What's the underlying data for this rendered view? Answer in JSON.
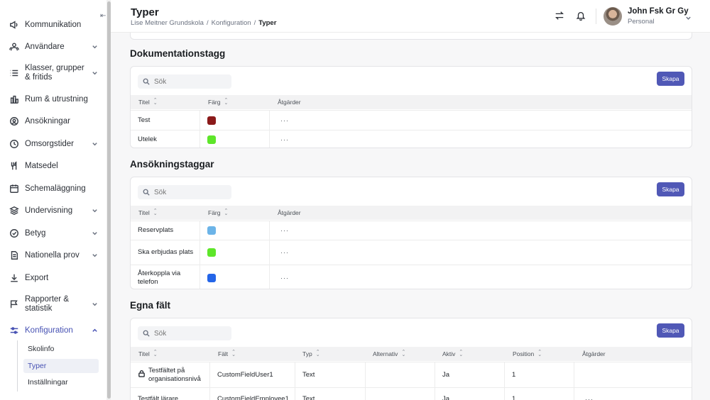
{
  "header": {
    "title": "Typer",
    "breadcrumb": [
      "Lise Meitner Grundskola",
      "Konfiguration",
      "Typer"
    ],
    "user_name": "John Fsk Gr Gy",
    "user_role": "Personal"
  },
  "sidebar": {
    "items": [
      {
        "label": "Kommunikation",
        "icon": "megaphone-icon"
      },
      {
        "label": "Användare",
        "icon": "users-icon"
      },
      {
        "label": "Klasser, grupper & fritids",
        "icon": "list-icon"
      },
      {
        "label": "Rum & utrustning",
        "icon": "building-icon"
      },
      {
        "label": "Ansökningar",
        "icon": "user-circle-icon"
      },
      {
        "label": "Omsorgstider",
        "icon": "clock-icon"
      },
      {
        "label": "Matsedel",
        "icon": "fork-knife-icon"
      },
      {
        "label": "Schemaläggning",
        "icon": "calendar-icon"
      },
      {
        "label": "Undervisning",
        "icon": "layers-icon"
      },
      {
        "label": "Betyg",
        "icon": "check-circle-icon"
      },
      {
        "label": "Nationella prov",
        "icon": "document-icon"
      },
      {
        "label": "Export",
        "icon": "download-icon"
      },
      {
        "label": "Rapporter & statistik",
        "icon": "flag-icon"
      },
      {
        "label": "Konfiguration",
        "icon": "sliders-icon"
      }
    ],
    "sub_items": [
      "Skolinfo",
      "Typer",
      "Inställningar"
    ]
  },
  "sections": {
    "doc_tags": {
      "title": "Dokumentationstagg",
      "search_placeholder": "Sök",
      "create_label": "Skapa",
      "columns": [
        "Titel",
        "Färg",
        "Åtgärder"
      ],
      "rows": [
        {
          "title": "Test",
          "color": "#8b1a1a",
          "actions": "···"
        },
        {
          "title": "Utelek",
          "color": "#5ee62a",
          "actions": "···"
        }
      ]
    },
    "app_tags": {
      "title": "Ansökningstaggar",
      "search_placeholder": "Sök",
      "create_label": "Skapa",
      "columns": [
        "Titel",
        "Färg",
        "Åtgärder"
      ],
      "rows": [
        {
          "title": "Reservplats",
          "color": "#6cb4e8",
          "actions": "···"
        },
        {
          "title": "Ska erbjudas plats",
          "color": "#5ee62a",
          "actions": "···"
        },
        {
          "title": "Återkoppla via telefon",
          "color": "#2465e8",
          "actions": "···"
        }
      ]
    },
    "custom_fields": {
      "title": "Egna fält",
      "search_placeholder": "Sök",
      "create_label": "Skapa",
      "columns": [
        "Titel",
        "Fält",
        "Typ",
        "Alternativ",
        "Aktiv",
        "Position",
        "Åtgärder"
      ],
      "rows": [
        {
          "title": "Testfältet på organisationsnivå",
          "field": "CustomFieldUser1",
          "type": "Text",
          "alternative": "",
          "active": "Ja",
          "position": "1",
          "actions": ""
        },
        {
          "title": "Testfält lärare",
          "field": "CustomFieldEmployee1",
          "type": "Text",
          "alternative": "",
          "active": "Ja",
          "position": "1",
          "actions": "···"
        }
      ]
    }
  },
  "colors": {
    "accent": "#5058b6",
    "active_nav": "#4651b3"
  }
}
